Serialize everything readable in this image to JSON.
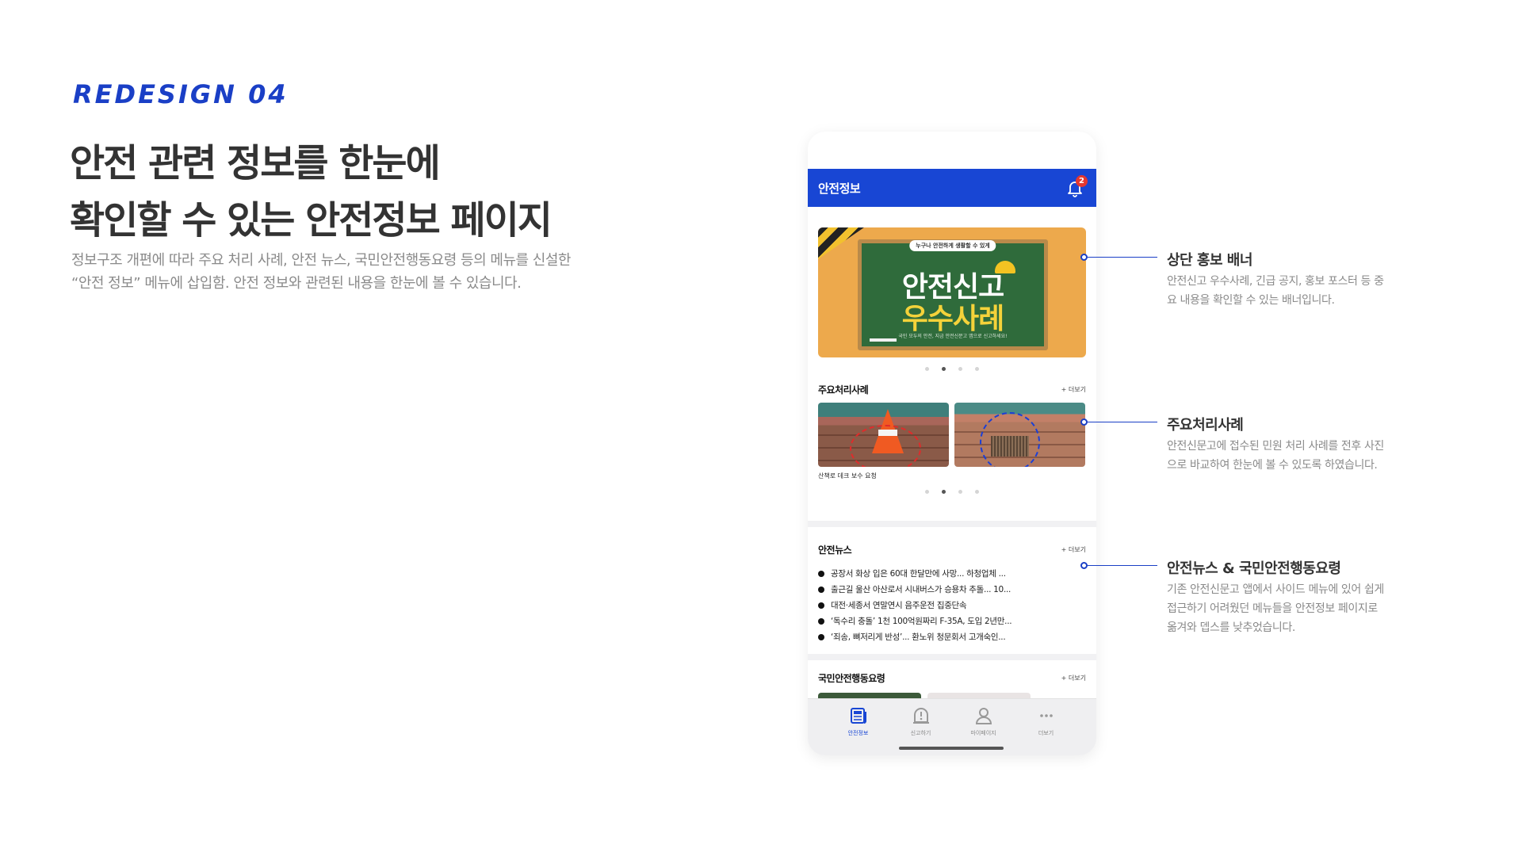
{
  "slide": {
    "tag": "REDESIGN 04",
    "headline_line1": "안전 관련 정보를 한눈에",
    "headline_line2": "확인할 수 있는 안전정보 페이지",
    "description": "정보구조 개편에 따라 주요 처리 사례, 안전 뉴스, 국민안전행동요령 등의 메뉴를 신설한 “안전 정보” 메뉴에 삽입함. 안전 정보와 관련된 내용을 한눈에 볼 수 있습니다."
  },
  "app": {
    "title": "안전정보",
    "notification_count": "2",
    "banner": {
      "pill": "누구나 안전하게 생활할 수 있게",
      "title_line1": "안전신고",
      "title_line2": "우수사례",
      "subtitle": "국민 모두의 안전, 지금 안전신문고 앱으로 신고하세요!"
    },
    "cases": {
      "title": "주요처리사례",
      "more": "+ 더보기",
      "caption": "산책로 데크 보수 요청"
    },
    "news": {
      "title": "안전뉴스",
      "more": "+ 더보기",
      "items": [
        "공장서 화상 입은 60대 한달만에 사망... 하청업체 ...",
        "출근길 울산 아산로서 시내버스가 승용차 추돌... 10...",
        "대전·세종서 연말연시 음주운전 집중단속",
        "‘독수리 충돌’ 1천 100억원짜리 F-35A, 도입 2년만...",
        "‘죄송, 뼈저리게 반성’... 환노위 청문회서 고개숙인..."
      ]
    },
    "actions": {
      "title": "국민안전행동요령",
      "more": "+ 더보기"
    },
    "tabbar": {
      "tabs": [
        {
          "label": "안전정보",
          "icon": "news-icon"
        },
        {
          "label": "신고하기",
          "icon": "report-icon"
        },
        {
          "label": "마이페이지",
          "icon": "person-icon"
        },
        {
          "label": "더보기",
          "icon": "more-icon"
        }
      ]
    }
  },
  "annotations": [
    {
      "title": "상단 홍보 배너",
      "text": "안전신고 우수사례, 긴급 공지, 홍보 포스터 등 중요 내용을 확인할 수 있는 배너입니다."
    },
    {
      "title": "주요처리사례",
      "text": "안전신문고에 접수된 민원 처리 사례를 전후 사진으로 바교하여 한눈에 볼 수 있도록 하였습니다."
    },
    {
      "title": "안전뉴스 & 국민안전행동요령",
      "text": "기존 안전신문고 앱에서 사이드 메뉴에 있어 쉽게 접근하기 어려웠던 메뉴들을 안전정보 페이지로 옮겨와 뎁스를 낮추었습니다."
    }
  ],
  "colors": {
    "accent": "#1a3fc6",
    "appbar": "#1846d4",
    "badge": "#e4362f"
  }
}
